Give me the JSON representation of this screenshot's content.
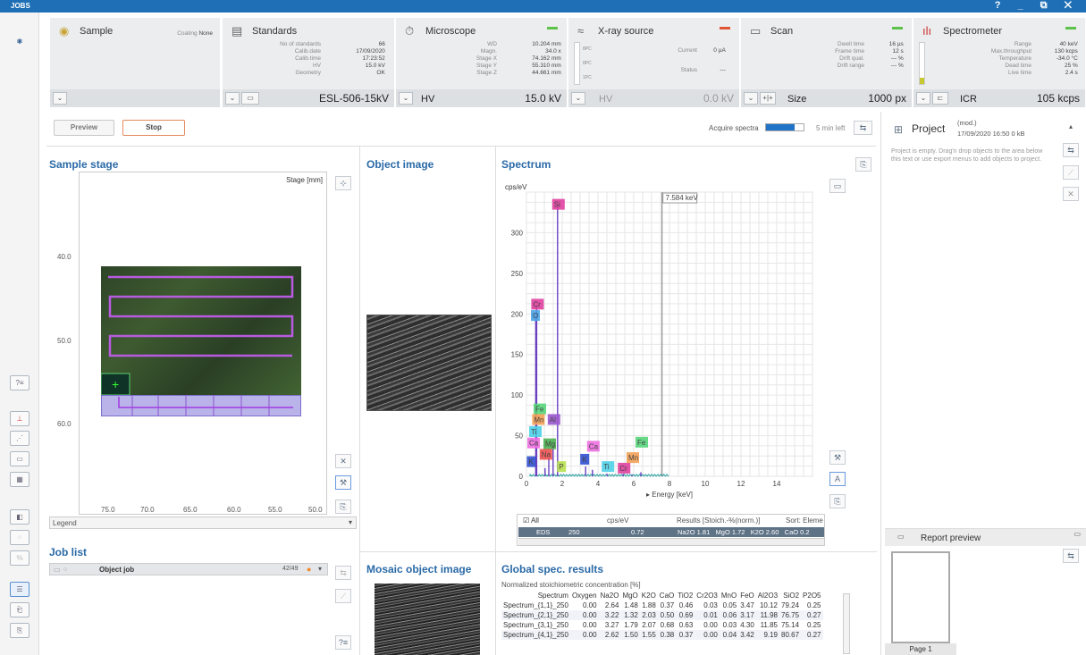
{
  "titlebar": {
    "title": "JOBS",
    "controls": "? _ ⧉ ✕"
  },
  "sample": {
    "title": "Sample",
    "coating_label": "Coating",
    "coating": "None"
  },
  "standards": {
    "title": "Standards",
    "rows": [
      [
        "No of standards",
        "66"
      ],
      [
        "Calib.date",
        "17/09/2020"
      ],
      [
        "Calib.time",
        "17:23:52"
      ],
      [
        "HV",
        "15.0 kV"
      ],
      [
        "Geometry",
        "OK"
      ]
    ],
    "value": "ESL-506-15kV"
  },
  "microscope": {
    "title": "Microscope",
    "rows": [
      [
        "WD",
        "10.204 mm"
      ],
      [
        "Magn.",
        "34.0 x"
      ],
      [
        "Stage X",
        "74.162 mm"
      ],
      [
        "Stage Y",
        "55.310 mm"
      ],
      [
        "Stage Z",
        "44.661 mm"
      ]
    ],
    "label": "HV",
    "value": "15.0 kV"
  },
  "xray": {
    "title": "X-ray source",
    "rows": [
      [
        "Current",
        "0 µA"
      ],
      [
        "Status",
        "---"
      ]
    ],
    "label": "HV",
    "value": "0.0 kV",
    "gauge": [
      "8PC",
      "8PC",
      "1PC"
    ]
  },
  "scan": {
    "title": "Scan",
    "rows": [
      [
        "Dwell time",
        "16 µs"
      ],
      [
        "Frame time",
        "12 s"
      ],
      [
        "Drift qual.",
        "--- %"
      ],
      [
        "Drift range",
        "--- %"
      ]
    ],
    "label": "Size",
    "value": "1000 px"
  },
  "spectrometer": {
    "title": "Spectrometer",
    "rows": [
      [
        "Range",
        "40 keV"
      ],
      [
        "Max.throughput",
        "130 kcps"
      ],
      [
        "Temperature",
        "-34.0 °C"
      ],
      [
        "Dead time",
        "25 %"
      ],
      [
        "Live time",
        "2.4 s"
      ]
    ],
    "label": "ICR",
    "value": "105 kcps",
    "icr_level": 0.15
  },
  "toolbar": {
    "preview": "Preview",
    "stop": "Stop",
    "acquire": "Acquire spectra",
    "remaining": "5 min left",
    "progress": 0.75
  },
  "stage": {
    "title": "Sample stage",
    "unit": "Stage [mm]",
    "y_ticks": [
      "40.0",
      "50.0",
      "60.0"
    ],
    "x_ticks": [
      "75.0",
      "70.0",
      "65.0",
      "60.0",
      "55.0",
      "50.0"
    ],
    "legend": "Legend"
  },
  "objectimage": {
    "title": "Object image"
  },
  "spectrum": {
    "title": "Spectrum",
    "ylabel": "cps/eV",
    "xlabel": "Energy [keV]",
    "cursor": "7.584 keV"
  },
  "chart_data": {
    "type": "line",
    "title": "Spectrum",
    "xlabel": "Energy [keV]",
    "ylabel": "cps/eV",
    "xlim": [
      0,
      16
    ],
    "ylim": [
      0,
      350
    ],
    "x_ticks": [
      0,
      2,
      4,
      6,
      8,
      10,
      12,
      14
    ],
    "y_ticks": [
      0,
      50,
      100,
      150,
      200,
      250,
      300
    ],
    "peaks": [
      {
        "x": 0.52,
        "y": 200
      },
      {
        "x": 0.57,
        "y": 210
      },
      {
        "x": 1.04,
        "y": 10
      },
      {
        "x": 1.25,
        "y": 22
      },
      {
        "x": 1.49,
        "y": 35
      },
      {
        "x": 1.74,
        "y": 335
      },
      {
        "x": 3.31,
        "y": 12
      },
      {
        "x": 3.69,
        "y": 8
      },
      {
        "x": 4.51,
        "y": 3
      },
      {
        "x": 5.41,
        "y": 3
      },
      {
        "x": 5.9,
        "y": 2
      },
      {
        "x": 6.4,
        "y": 5
      }
    ],
    "labels": [
      {
        "t": "Si",
        "x": 1.74,
        "y": 335,
        "c": "#e040a0"
      },
      {
        "t": "Cr",
        "x": 0.57,
        "y": 212,
        "c": "#e040a0"
      },
      {
        "t": "O",
        "x": 0.55,
        "y": 198,
        "c": "#4aa3e8"
      },
      {
        "t": "Fe",
        "x": 0.7,
        "y": 83,
        "c": "#57d67a"
      },
      {
        "t": "Mn",
        "x": 0.62,
        "y": 70,
        "c": "#f4a055"
      },
      {
        "t": "Al",
        "x": 1.49,
        "y": 70,
        "c": "#9b59d0"
      },
      {
        "t": "Ti",
        "x": 0.45,
        "y": 55,
        "c": "#4fd0e8"
      },
      {
        "t": "Ca",
        "x": 0.35,
        "y": 41,
        "c": "#ee6fe0"
      },
      {
        "t": "Mg",
        "x": 1.25,
        "y": 40,
        "c": "#4caf50"
      },
      {
        "t": "Na",
        "x": 1.04,
        "y": 27,
        "c": "#f05050"
      },
      {
        "t": "K",
        "x": 0.32,
        "y": 18,
        "c": "#3050d0"
      },
      {
        "t": "P",
        "x": 2.01,
        "y": 12,
        "c": "#b7e050"
      },
      {
        "t": "Ca",
        "x": 3.69,
        "y": 37,
        "c": "#ee6fe0"
      },
      {
        "t": "K",
        "x": 3.31,
        "y": 21,
        "c": "#3050d0"
      },
      {
        "t": "Ti",
        "x": 4.51,
        "y": 12,
        "c": "#4fd0e8"
      },
      {
        "t": "Cr",
        "x": 5.41,
        "y": 10,
        "c": "#e040a0"
      },
      {
        "t": "Mn",
        "x": 5.9,
        "y": 23,
        "c": "#f4a055"
      },
      {
        "t": "Fe",
        "x": 6.4,
        "y": 42,
        "c": "#57d67a"
      }
    ]
  },
  "spectrum_list": {
    "all": "All",
    "col_cps": "cps/eV",
    "col_results": "Results [Stoich.-%(norm.)]",
    "col_sort": "Sort: Eleme",
    "row": {
      "name": "EDS",
      "n": "250",
      "cps": "0.72",
      "results": "Na2O 1.81   MgO 1.72   K2O 2.60   CaO 0.2"
    }
  },
  "joblist": {
    "title": "Job list",
    "job": "Object job",
    "progress": "42/49"
  },
  "mosaic": {
    "title": "Mosaic object image"
  },
  "global": {
    "title": "Global spec. results",
    "subtitle": "Normalized stoichiometric concentration [%]",
    "headers": [
      "Spectrum",
      "Oxygen",
      "Na2O",
      "MgO",
      "K2O",
      "CaO",
      "TiO2",
      "Cr2O3",
      "MnO",
      "FeO",
      "Al2O3",
      "SiO2",
      "P2O5"
    ],
    "rows": [
      [
        "Spectrum_{1,1}_250",
        "0.00",
        "2.64",
        "1.48",
        "1.88",
        "0.37",
        "0.46",
        "0.03",
        "0.05",
        "3.47",
        "10.12",
        "79.24",
        "0.25"
      ],
      [
        "Spectrum_{2,1}_250",
        "0.00",
        "3.22",
        "1.32",
        "2.03",
        "0.50",
        "0.69",
        "0.01",
        "0.06",
        "3.17",
        "11.98",
        "76.75",
        "0.27"
      ],
      [
        "Spectrum_{3,1}_250",
        "0.00",
        "3.27",
        "1.79",
        "2.07",
        "0.68",
        "0.63",
        "0.00",
        "0.03",
        "4.30",
        "11.85",
        "75.14",
        "0.25"
      ],
      [
        "Spectrum_{4,1}_250",
        "0.00",
        "2.62",
        "1.50",
        "1.55",
        "0.38",
        "0.37",
        "0.00",
        "0.04",
        "3.42",
        "9.19",
        "80.67",
        "0.27"
      ]
    ]
  },
  "project": {
    "title": "Project",
    "mod": "(mod.)",
    "date": "17/09/2020 16:50  0 kB",
    "empty": "Project is empty. Drag'n drop objects to the area below this text or use export menus to add objects to project."
  },
  "report": {
    "title": "Report preview",
    "page": "Page 1"
  }
}
